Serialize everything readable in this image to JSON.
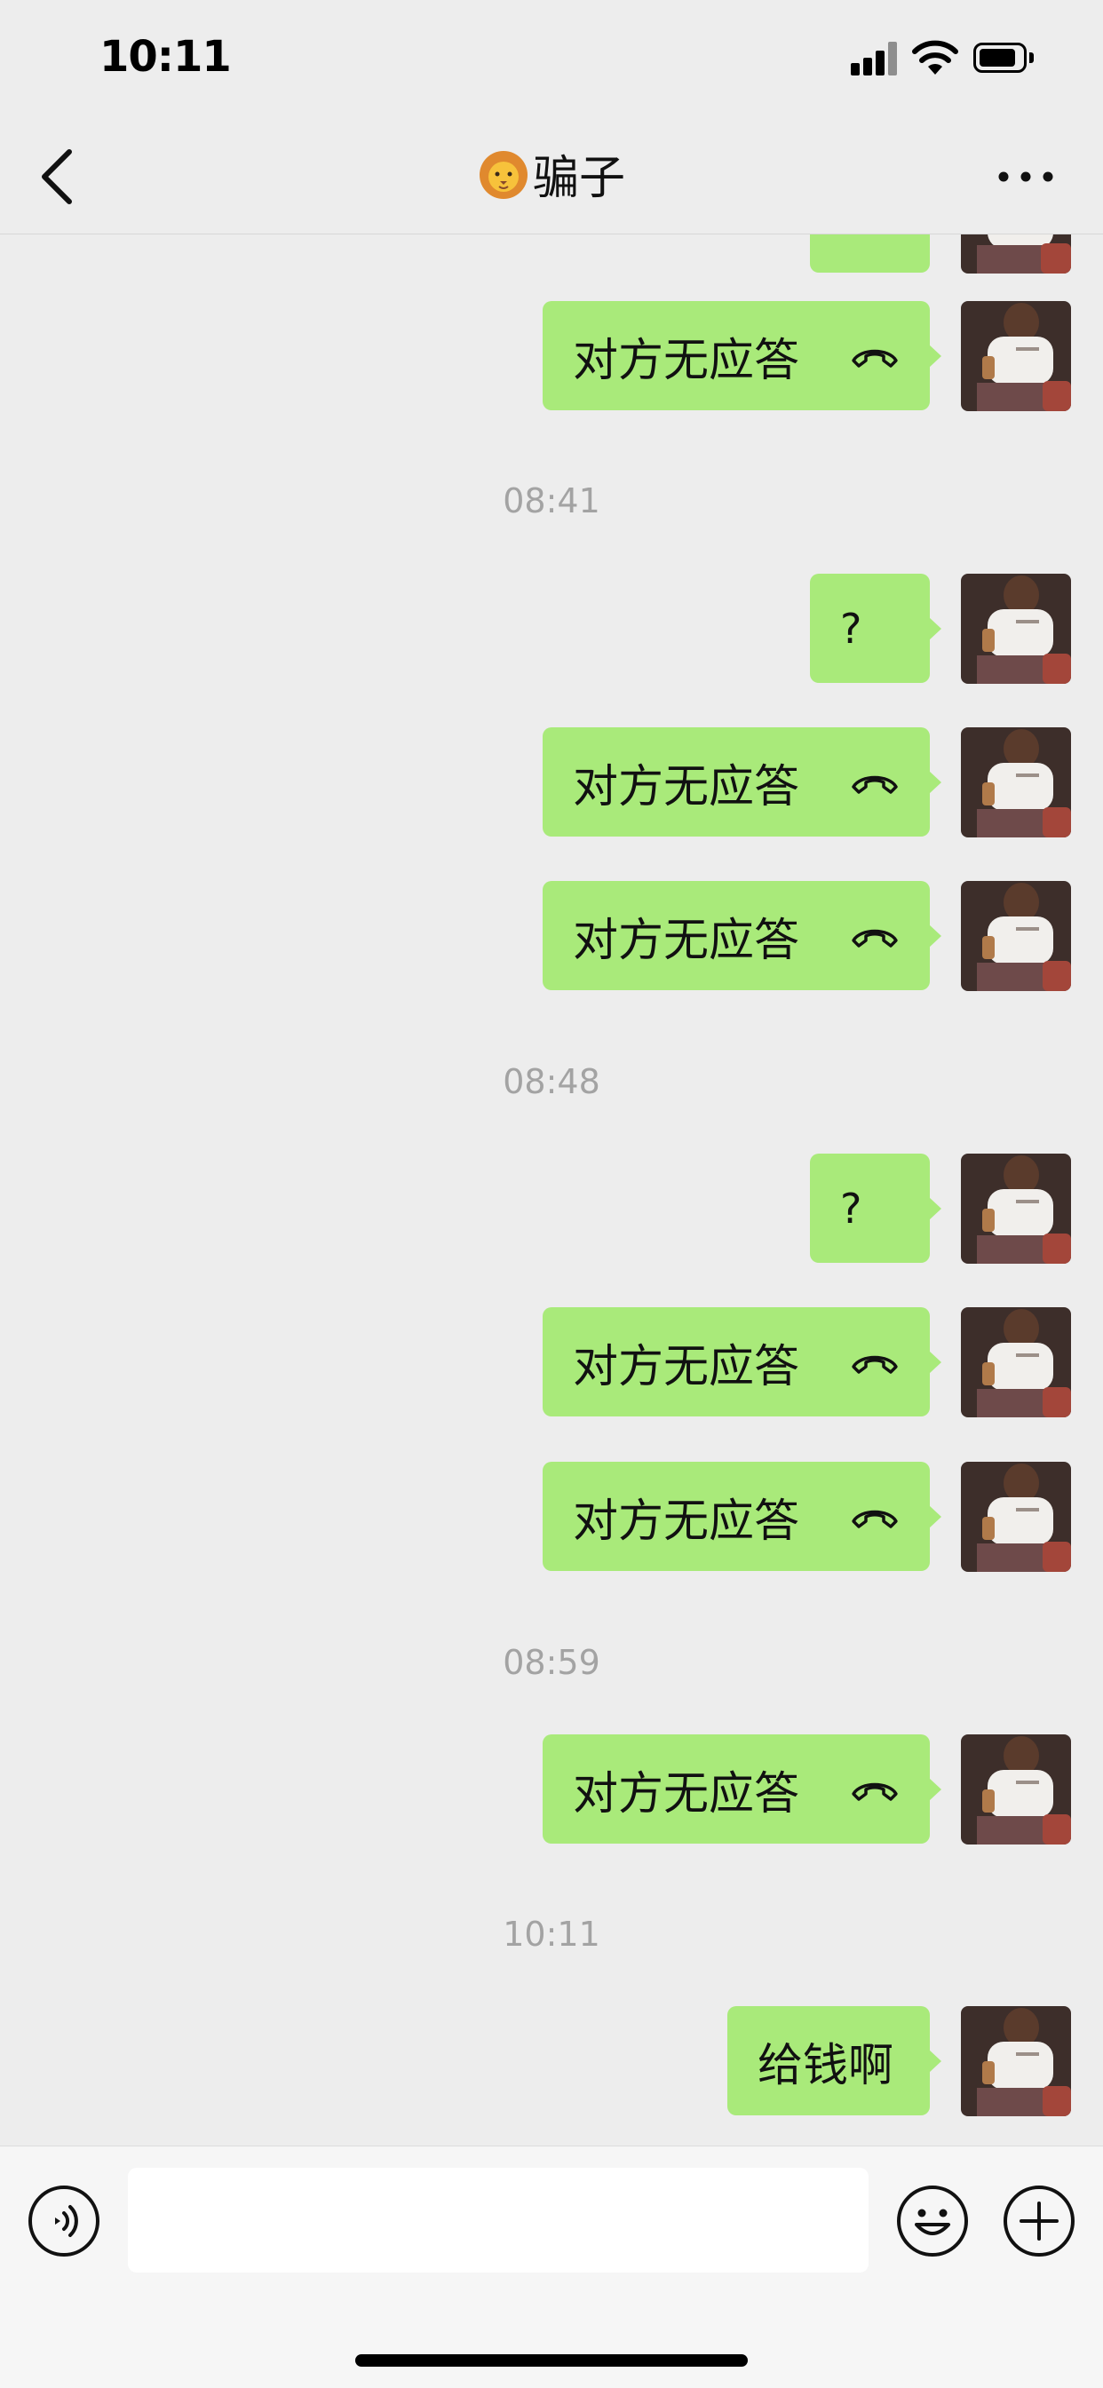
{
  "status_bar": {
    "time": "10:11"
  },
  "header": {
    "title": "骗子",
    "title_icon": "lion-emoji-icon",
    "back_icon": "chevron-left-icon",
    "more_icon": "more-dots-icon"
  },
  "messages": [
    {
      "type": "call",
      "text": "对方无应答",
      "icon": "hang-up-phone-icon"
    },
    {
      "type": "timestamp",
      "text": "08:41"
    },
    {
      "type": "text",
      "text": "?"
    },
    {
      "type": "call",
      "text": "对方无应答",
      "icon": "hang-up-phone-icon"
    },
    {
      "type": "call",
      "text": "对方无应答",
      "icon": "hang-up-phone-icon"
    },
    {
      "type": "timestamp",
      "text": "08:48"
    },
    {
      "type": "text",
      "text": "?"
    },
    {
      "type": "call",
      "text": "对方无应答",
      "icon": "hang-up-phone-icon"
    },
    {
      "type": "call",
      "text": "对方无应答",
      "icon": "hang-up-phone-icon"
    },
    {
      "type": "timestamp",
      "text": "08:59"
    },
    {
      "type": "call",
      "text": "对方无应答",
      "icon": "hang-up-phone-icon"
    },
    {
      "type": "timestamp",
      "text": "10:11"
    },
    {
      "type": "text",
      "text": "给钱啊"
    }
  ],
  "input_bar": {
    "input_value": "",
    "voice_icon": "voice-input-icon",
    "emoji_icon": "emoji-smile-icon",
    "add_icon": "plus-circle-icon"
  },
  "colors": {
    "background": "#ededed",
    "bubble_green": "#a9ea7a",
    "timestamp_gray": "#a3a3a3",
    "input_bar_bg": "#f6f6f6"
  }
}
